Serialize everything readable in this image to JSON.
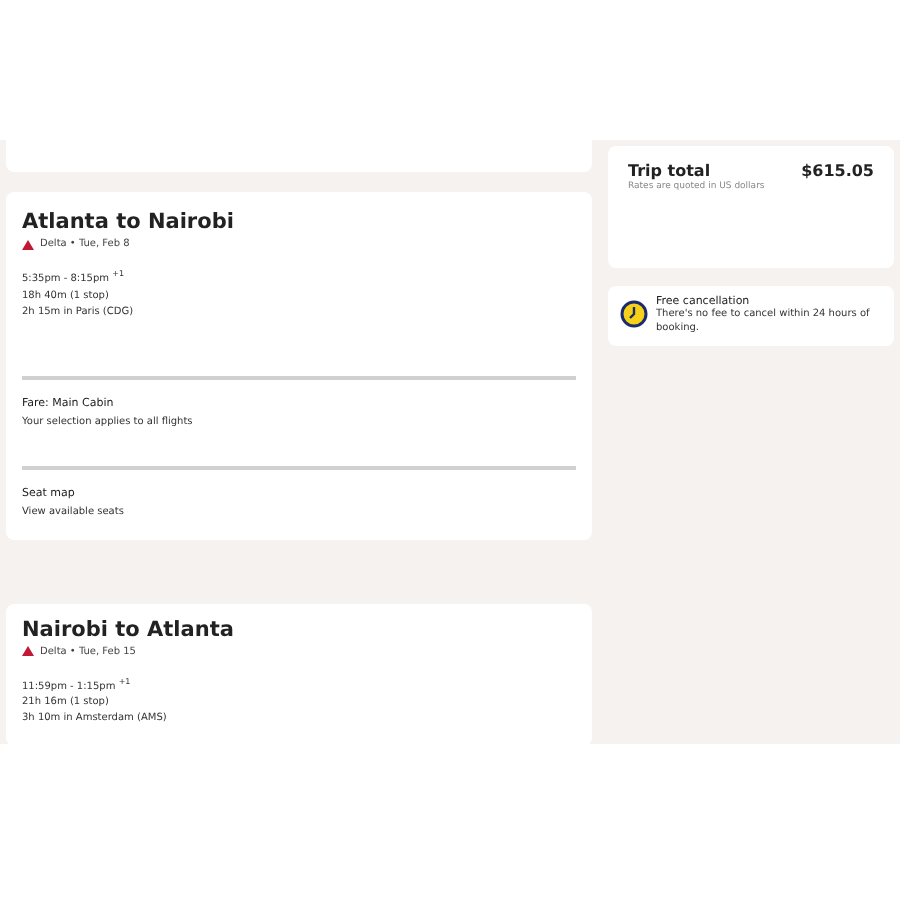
{
  "flights": [
    {
      "title": "Atlanta to Nairobi",
      "meta": "Delta • Tue, Feb 8",
      "times": "5:35pm - 8:15pm $^{+1}$",
      "duration": "18h 40m (1 stop)",
      "layover": "2h 15m in Paris (CDG)",
      "sections": [
        {
          "title": "Fare: Main Cabin",
          "text": "Your selection applies to all flights"
        },
        {
          "title": "Seat map",
          "text": "View available seats"
        }
      ]
    },
    {
      "title": "Nairobi to Atlanta",
      "meta": "Delta • Tue, Feb 15",
      "times": "11:59pm - 1:15pm $^{+1}$",
      "duration": "21h 16m (1 stop)",
      "layover": "3h 10m in Amsterdam (AMS)"
    }
  ],
  "trip_total": {
    "label": "Trip total",
    "amount": "$615.05",
    "note": "Rates are quoted in US dollars"
  },
  "cancellation": {
    "title": "Free cancellation",
    "text": "There's no fee to cancel within 24 hours of booking."
  }
}
